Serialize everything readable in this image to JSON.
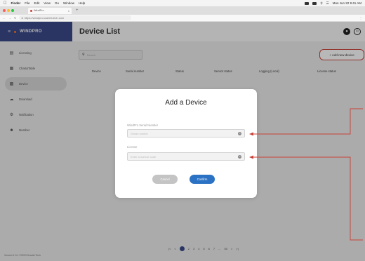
{
  "menubar": {
    "apple_icon": "apple-logo-icon",
    "items": [
      "Finder",
      "File",
      "Edit",
      "View",
      "Go",
      "Window",
      "Help"
    ],
    "clock": "Mon Jun 22  9:41 AM"
  },
  "browser": {
    "tab_title": "WindPro",
    "url": "https://windpro.scarlet-tech.com"
  },
  "sidebar": {
    "brand": "WINDPRO",
    "items": [
      {
        "label": "Licensing",
        "icon": "license-icon"
      },
      {
        "label": "Chart&Table",
        "icon": "chart-icon"
      },
      {
        "label": "Device",
        "icon": "device-icon",
        "active": true
      },
      {
        "label": "Download",
        "icon": "download-icon"
      },
      {
        "label": "Notification",
        "icon": "gear-icon"
      },
      {
        "label": "Member",
        "icon": "users-icon"
      }
    ],
    "version": "Version 1.0.1  ©2023 Scarlet Tech"
  },
  "header": {
    "title": "Device List"
  },
  "toolbar": {
    "search_placeholder": "Search",
    "add_button": "+ Add new device"
  },
  "table": {
    "columns": [
      "Device",
      "Serial number",
      "Status",
      "Sensor status",
      "Logging (Local)",
      "License status"
    ]
  },
  "pagination": {
    "items": [
      "|<",
      "<",
      "1",
      "2",
      "3",
      "4",
      "5",
      "6",
      "7",
      "...",
      "50",
      ">",
      ">|"
    ],
    "current": 1
  },
  "modal": {
    "title": "Add a Device",
    "serial_label": "WindPro Serial Number",
    "serial_placeholder": "Serial number",
    "license_label": "License",
    "license_placeholder": "Enter a license code",
    "cancel_label": "Cancel",
    "confirm_label": "Confirm"
  },
  "colors": {
    "brand": "#3b4a8b",
    "accent": "#2b72c4",
    "callout": "#c9433a"
  }
}
